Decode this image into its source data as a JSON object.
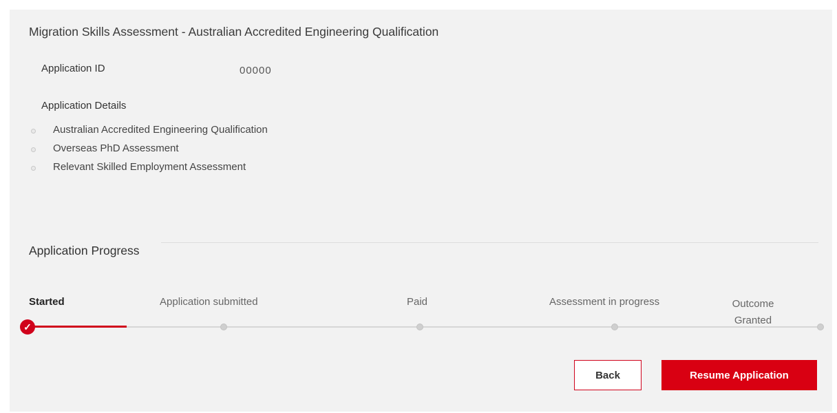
{
  "header": {
    "title": "Migration Skills Assessment - Australian Accredited Engineering Qualification"
  },
  "application": {
    "id_label": "Application ID",
    "id_value": "00000",
    "details_label": "Application Details",
    "details": [
      "Australian Accredited Engineering Qualification",
      "Overseas PhD Assessment",
      "Relevant Skilled Employment Assessment"
    ]
  },
  "progress": {
    "heading": "Application Progress",
    "steps": [
      {
        "label": "Started",
        "status": "completed"
      },
      {
        "label": "Application submitted",
        "status": "pending"
      },
      {
        "label": "Paid",
        "status": "pending"
      },
      {
        "label": "Assessment in progress",
        "status": "pending"
      },
      {
        "label": "Outcome Granted",
        "status": "pending"
      }
    ],
    "check_icon": "check-icon"
  },
  "actions": {
    "back_label": "Back",
    "resume_label": "Resume Application"
  },
  "colors": {
    "accent": "#d0021b",
    "panel_background": "#f2f2f2"
  }
}
